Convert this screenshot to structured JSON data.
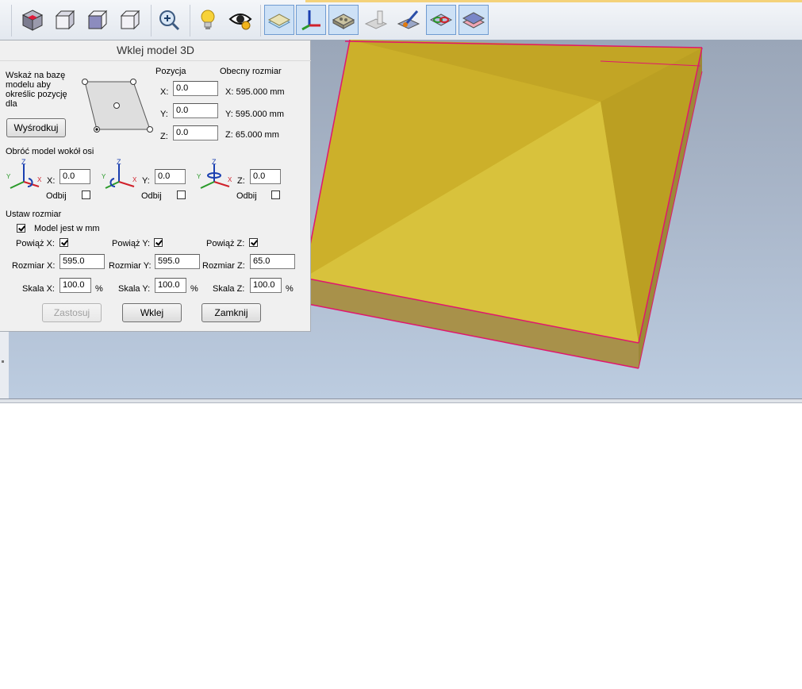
{
  "toolbar": {
    "buttons": [
      {
        "icon": "cube-red-corner-icon",
        "active": false
      },
      {
        "icon": "wireframe-cube-icon",
        "active": false
      },
      {
        "icon": "shaded-cube-icon",
        "active": false
      },
      {
        "icon": "wireframe-box-icon",
        "active": false
      },
      {
        "icon": "zoom-in-icon",
        "active": false
      },
      {
        "icon": "lightbulb-icon",
        "active": false
      },
      {
        "icon": "eye-icon",
        "active": false
      },
      {
        "icon": "plane-layer-icon",
        "active": true
      },
      {
        "icon": "axes-icon",
        "active": true
      },
      {
        "icon": "material-block-icon",
        "active": true
      },
      {
        "icon": "tool-shape-icon",
        "active": false
      },
      {
        "icon": "paint-brush-icon",
        "active": false
      },
      {
        "icon": "toolpath-preview-icon",
        "active": true
      },
      {
        "icon": "layers-icon",
        "active": true
      }
    ]
  },
  "dialog": {
    "title": "Wklej model 3D",
    "base_hint": "Wskaż na bazę\nmodelu aby\nokreślic pozycję\ndla",
    "center_button": "Wyśrodkuj",
    "position": {
      "header": "Pozycja",
      "x_label": "X:",
      "x_value": "0.0",
      "y_label": "Y:",
      "y_value": "0.0",
      "z_label": "Z:",
      "z_value": "0.0"
    },
    "current_size": {
      "header": "Obecny rozmiar",
      "x": "X:  595.000 mm",
      "y": "Y:  595.000 mm",
      "z": "Z:  65.000 mm"
    },
    "rotate": {
      "header": "Obróć model wokół osi",
      "x_label": "X:",
      "x_value": "0.0",
      "y_label": "Y:",
      "y_value": "0.0",
      "z_label": "Z:",
      "z_value": "0.0",
      "mirror_label": "Odbij",
      "axis_letters": {
        "x": "X",
        "y": "Y",
        "z": "Z"
      }
    },
    "size": {
      "header": "Ustaw rozmiar",
      "model_in_mm_label": "Model jest w mm",
      "model_in_mm_checked": true,
      "link_x_label": "Powiąż X:",
      "link_x_checked": true,
      "link_y_label": "Powiąż Y:",
      "link_y_checked": true,
      "link_z_label": "Powiąż Z:",
      "link_z_checked": true,
      "size_x_label": "Rozmiar X:",
      "size_x_value": "595.0",
      "size_y_label": "Rozmiar Y:",
      "size_y_value": "595.0",
      "size_z_label": "Rozmiar Z:",
      "size_z_value": "65.0",
      "scale_x_label": "Skala X:",
      "scale_x_value": "100.0",
      "scale_y_label": "Skala Y:",
      "scale_y_value": "100.0",
      "scale_z_label": "Skala Z:",
      "scale_z_value": "100.0",
      "percent": "%"
    },
    "buttons": {
      "apply": "Zastosuj",
      "paste": "Wklej",
      "close": "Zamknij"
    }
  },
  "colors": {
    "model_face": "#d4b82c",
    "model_edge": "#e0166e",
    "viewport_top": "#9aa6b8",
    "viewport_bottom": "#bccce0",
    "active_toggle": "#cde1f6"
  }
}
